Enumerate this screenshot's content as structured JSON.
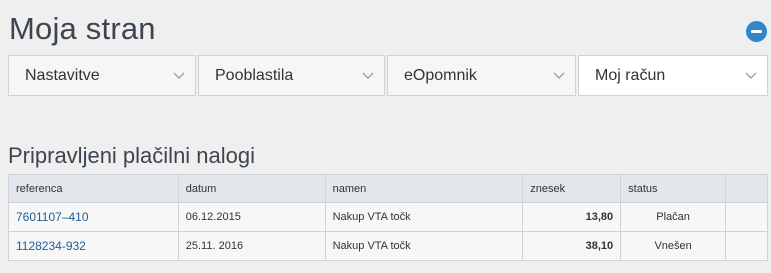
{
  "page": {
    "title": "Moja stran"
  },
  "menu": [
    {
      "label": "Nastavitve"
    },
    {
      "label": "Pooblastila"
    },
    {
      "label": "eOpomnik"
    },
    {
      "label": "Moj račun"
    }
  ],
  "orders": {
    "title": "Pripravljeni plačilni nalogi",
    "columns": [
      "referenca",
      "datum",
      "namen",
      "znesek",
      "status",
      ""
    ],
    "rows": [
      {
        "reference": "7601107–410",
        "date": "06.12.2015",
        "purpose": "Nakup VTA točk",
        "amount": "13,80",
        "status": "Plačan"
      },
      {
        "reference": "1128234-932",
        "date": "25.11. 2016",
        "purpose": "Nakup VTA točk",
        "amount": "38,10",
        "status": "Vnešen"
      }
    ]
  },
  "colors": {
    "accent": "#2f86c8",
    "link": "#1e5c99",
    "header_bg": "#e3e7ec"
  },
  "icons": {
    "collapse": "minus-circle-icon",
    "dropdown": "chevron-down-icon"
  }
}
